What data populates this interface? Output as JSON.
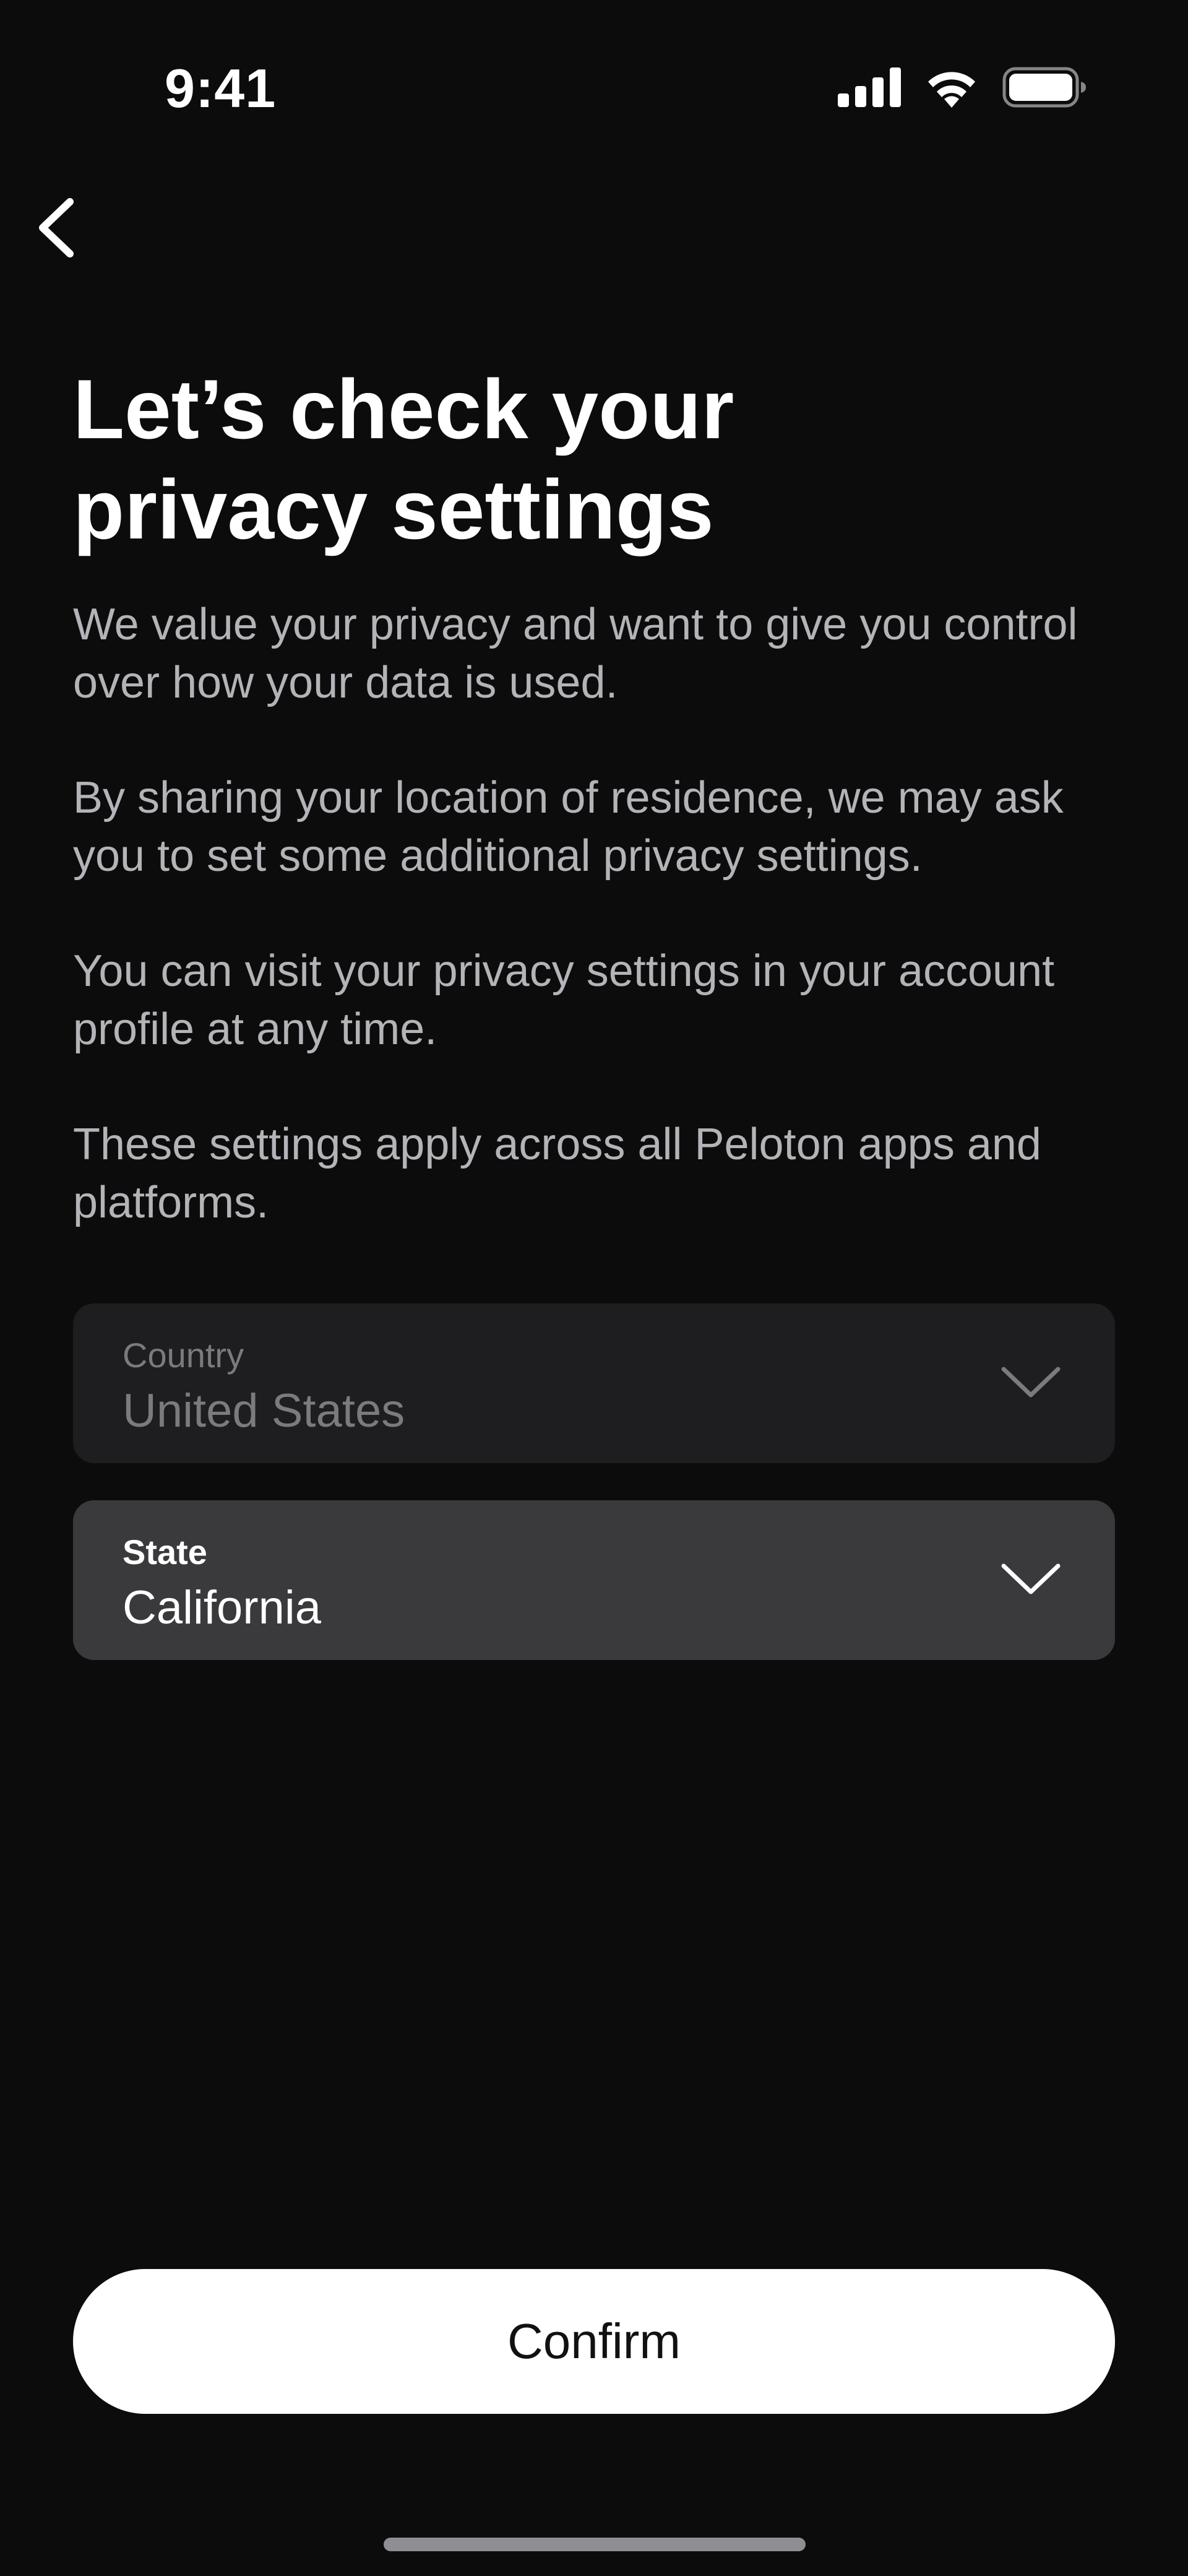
{
  "status_bar": {
    "time": "9:41",
    "icons": [
      "cellular-signal-icon",
      "wifi-icon",
      "battery-icon"
    ]
  },
  "navigation": {
    "back_icon": "chevron-left-icon"
  },
  "content": {
    "title_line1": "Let’s check your",
    "title_line2": "privacy settings",
    "paragraph1": "We value your privacy and want to give you control over how your data is used.",
    "paragraph2": "By sharing your location of residence, we may ask you to set some additional privacy settings.",
    "paragraph3": "You can visit your privacy settings in your account profile at any time.",
    "paragraph4": "These settings apply across all Peloton apps and platforms."
  },
  "form": {
    "country": {
      "label": "Country",
      "value": "United States",
      "icon": "chevron-down-icon"
    },
    "state": {
      "label": "State",
      "value": "California",
      "icon": "chevron-down-icon"
    }
  },
  "actions": {
    "confirm_label": "Confirm"
  },
  "colors": {
    "background": "#0c0c0d",
    "text_primary": "#ffffff",
    "text_secondary": "#b3b3b8",
    "field_disabled": "#1e1e20",
    "field_active": "#3a3a3d",
    "button_bg": "#ffffff"
  }
}
